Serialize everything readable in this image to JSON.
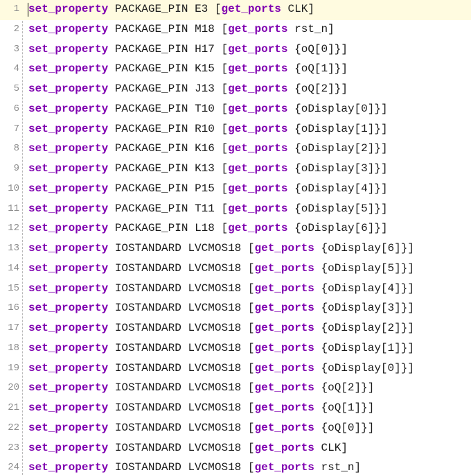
{
  "editor": {
    "lines": [
      {
        "num": "1",
        "cmd": "set_property",
        "prop": "PACKAGE_PIN",
        "val": "E3",
        "sub": "get_ports",
        "port": "CLK]"
      },
      {
        "num": "2",
        "cmd": "set_property",
        "prop": "PACKAGE_PIN",
        "val": "M18",
        "sub": "get_ports",
        "port": "rst_n]"
      },
      {
        "num": "3",
        "cmd": "set_property",
        "prop": "PACKAGE_PIN",
        "val": "H17",
        "sub": "get_ports",
        "port": "{oQ[0]}]"
      },
      {
        "num": "4",
        "cmd": "set_property",
        "prop": "PACKAGE_PIN",
        "val": "K15",
        "sub": "get_ports",
        "port": "{oQ[1]}]"
      },
      {
        "num": "5",
        "cmd": "set_property",
        "prop": "PACKAGE_PIN",
        "val": "J13",
        "sub": "get_ports",
        "port": "{oQ[2]}]"
      },
      {
        "num": "6",
        "cmd": "set_property",
        "prop": "PACKAGE_PIN",
        "val": "T10",
        "sub": "get_ports",
        "port": "{oDisplay[0]}]"
      },
      {
        "num": "7",
        "cmd": "set_property",
        "prop": "PACKAGE_PIN",
        "val": "R10",
        "sub": "get_ports",
        "port": "{oDisplay[1]}]"
      },
      {
        "num": "8",
        "cmd": "set_property",
        "prop": "PACKAGE_PIN",
        "val": "K16",
        "sub": "get_ports",
        "port": "{oDisplay[2]}]"
      },
      {
        "num": "9",
        "cmd": "set_property",
        "prop": "PACKAGE_PIN",
        "val": "K13",
        "sub": "get_ports",
        "port": "{oDisplay[3]}]"
      },
      {
        "num": "10",
        "cmd": "set_property",
        "prop": "PACKAGE_PIN",
        "val": "P15",
        "sub": "get_ports",
        "port": "{oDisplay[4]}]"
      },
      {
        "num": "11",
        "cmd": "set_property",
        "prop": "PACKAGE_PIN",
        "val": "T11",
        "sub": "get_ports",
        "port": "{oDisplay[5]}]"
      },
      {
        "num": "12",
        "cmd": "set_property",
        "prop": "PACKAGE_PIN",
        "val": "L18",
        "sub": "get_ports",
        "port": "{oDisplay[6]}]"
      },
      {
        "num": "13",
        "cmd": "set_property",
        "prop": "IOSTANDARD",
        "val": "LVCMOS18",
        "sub": "get_ports",
        "port": "{oDisplay[6]}]"
      },
      {
        "num": "14",
        "cmd": "set_property",
        "prop": "IOSTANDARD",
        "val": "LVCMOS18",
        "sub": "get_ports",
        "port": "{oDisplay[5]}]"
      },
      {
        "num": "15",
        "cmd": "set_property",
        "prop": "IOSTANDARD",
        "val": "LVCMOS18",
        "sub": "get_ports",
        "port": "{oDisplay[4]}]"
      },
      {
        "num": "16",
        "cmd": "set_property",
        "prop": "IOSTANDARD",
        "val": "LVCMOS18",
        "sub": "get_ports",
        "port": "{oDisplay[3]}]"
      },
      {
        "num": "17",
        "cmd": "set_property",
        "prop": "IOSTANDARD",
        "val": "LVCMOS18",
        "sub": "get_ports",
        "port": "{oDisplay[2]}]"
      },
      {
        "num": "18",
        "cmd": "set_property",
        "prop": "IOSTANDARD",
        "val": "LVCMOS18",
        "sub": "get_ports",
        "port": "{oDisplay[1]}]"
      },
      {
        "num": "19",
        "cmd": "set_property",
        "prop": "IOSTANDARD",
        "val": "LVCMOS18",
        "sub": "get_ports",
        "port": "{oDisplay[0]}]"
      },
      {
        "num": "20",
        "cmd": "set_property",
        "prop": "IOSTANDARD",
        "val": "LVCMOS18",
        "sub": "get_ports",
        "port": "{oQ[2]}]"
      },
      {
        "num": "21",
        "cmd": "set_property",
        "prop": "IOSTANDARD",
        "val": "LVCMOS18",
        "sub": "get_ports",
        "port": "{oQ[1]}]"
      },
      {
        "num": "22",
        "cmd": "set_property",
        "prop": "IOSTANDARD",
        "val": "LVCMOS18",
        "sub": "get_ports",
        "port": "{oQ[0]}]"
      },
      {
        "num": "23",
        "cmd": "set_property",
        "prop": "IOSTANDARD",
        "val": "LVCMOS18",
        "sub": "get_ports",
        "port": "CLK]"
      },
      {
        "num": "24",
        "cmd": "set_property",
        "prop": "IOSTANDARD",
        "val": "LVCMOS18",
        "sub": "get_ports",
        "port": "rst_n]"
      }
    ]
  }
}
